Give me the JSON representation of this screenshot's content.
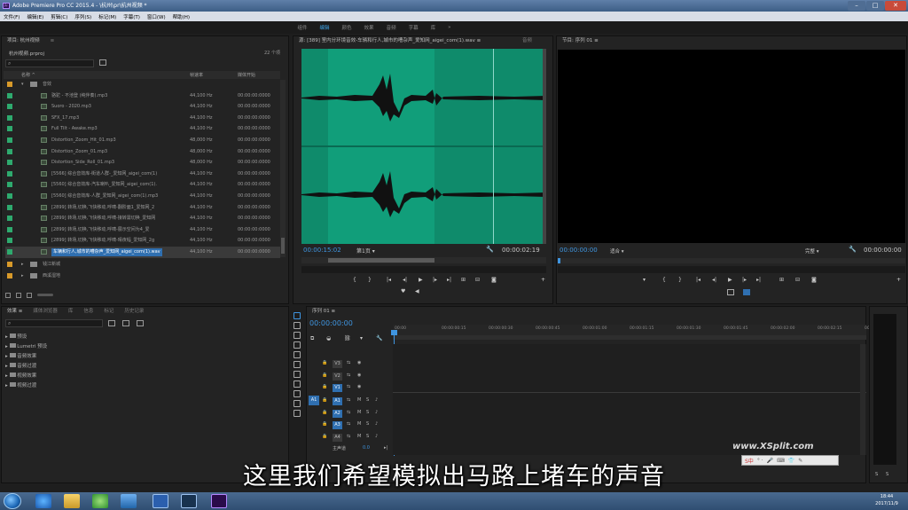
{
  "window": {
    "title": "Adobe Premiere Pro CC 2015.4 - \\杭州\\pr\\杭州视频 *",
    "app_icon": "Pr"
  },
  "menu": [
    "文件(F)",
    "编辑(E)",
    "剪辑(C)",
    "序列(S)",
    "标记(M)",
    "字幕(T)",
    "窗口(W)",
    "帮助(H)"
  ],
  "workspaces": {
    "items": [
      "组件",
      "编辑",
      "颜色",
      "效果",
      "音频",
      "字幕",
      "库"
    ],
    "active_index": 1
  },
  "project": {
    "tabs": [
      "项目: 杭州视频",
      "≡"
    ],
    "file": "杭州视频.prproj",
    "item_count": "22 个项",
    "columns": {
      "name": "名称 ^",
      "rate": "帧速率",
      "start": "媒体开始"
    },
    "bins": [
      {
        "name": "音效",
        "color": "#d89a2a"
      }
    ],
    "items": [
      {
        "name": "骆驼 - 不池登 (纯伴奏).mp3",
        "rate": "44,100 Hz",
        "start": "00:00:00:0000"
      },
      {
        "name": "Suoro - 2020.mp3",
        "rate": "44,100 Hz",
        "start": "00:00:00:0000"
      },
      {
        "name": "SFX_17.mp3",
        "rate": "44,100 Hz",
        "start": "00:00:00:0000"
      },
      {
        "name": "Full Tilt - Awake.mp3",
        "rate": "44,100 Hz",
        "start": "00:00:00:0000"
      },
      {
        "name": "Distortion_Zoom_Hit_01.mp3",
        "rate": "48,000 Hz",
        "start": "00:00:00:0000"
      },
      {
        "name": "Distortion_Zoom_01.mp3",
        "rate": "48,000 Hz",
        "start": "00:00:00:0000"
      },
      {
        "name": "Distortion_Side_Roll_01.mp3",
        "rate": "48,000 Hz",
        "start": "00:00:00:0000"
      },
      {
        "name": "[5566] 综合音效库-街道人群-_爱知网_aigei_com(1)",
        "rate": "44,100 Hz",
        "start": "00:00:00:0000"
      },
      {
        "name": "[5560] 综合音效库-汽车喇叭_爱知网_aigei_com(1).",
        "rate": "44,100 Hz",
        "start": "00:00:00:0000"
      },
      {
        "name": "[5560] 综合音效库-人群_爱知网_aigei_com(1).mp3",
        "rate": "44,100 Hz",
        "start": "00:00:00:0000"
      },
      {
        "name": "[2899] 转场,切换,飞快移动,呼啸-翻阶面1_爱知网_2",
        "rate": "44,100 Hz",
        "start": "00:00:00:0000"
      },
      {
        "name": "[2899] 转场,切换,飞快移动,呼啸-接转需切换_爱知网",
        "rate": "44,100 Hz",
        "start": "00:00:00:0000"
      },
      {
        "name": "[2899] 转场,切换,飞快移动,呼啸-展示空间为4_爱",
        "rate": "44,100 Hz",
        "start": "00:00:00:0000"
      },
      {
        "name": "[2899] 转场,切换,飞快移动,呼啸-晴夜幅_爱知网_2g",
        "rate": "44,100 Hz",
        "start": "00:00:00:0000"
      },
      {
        "name": "车辆和行人,城市的嘈杂声_爱知网_aigei_com(1).wav",
        "rate": "44,100 Hz",
        "start": "00:00:00:0000"
      }
    ],
    "folders": [
      {
        "name": "钱江新城",
        "color": "#d89a2a"
      },
      {
        "name": "西溪湿地",
        "color": "#d89a2a"
      }
    ]
  },
  "source": {
    "tab": "源: [389] 室内分环境音效-车辆和行人,城市的嘈杂声_爱知网_aigei_com(1).wav ≡",
    "tab2": "音频",
    "timecode_in": "00:00:15:02",
    "page": "第1页",
    "timecode_out": "00:00:02:19"
  },
  "program": {
    "tab": "节目: 序列 01 ≡",
    "timecode": "00:00:00:00",
    "fit": "适合",
    "quality": "完整",
    "duration": "00:00:00:00"
  },
  "effects": {
    "tabs": [
      "效果 ≡",
      "媒体浏览器",
      "库",
      "信息",
      "标记",
      "历史记录"
    ],
    "items": [
      "预设",
      "Lumetri 预设",
      "音频效果",
      "音频过渡",
      "视频效果",
      "视频过渡"
    ]
  },
  "timeline": {
    "tab": "序列 01 ≡",
    "timecode": "00:00:00:00",
    "ruler": [
      "00:00",
      "00:00:00:15",
      "00:00:00:30",
      "00:00:00:45",
      "00:00:01:00",
      "00:00:01:15",
      "00:00:01:30",
      "00:00:01:45",
      "00:00:02:00",
      "00:00:02:15",
      "00:00:02:30"
    ],
    "video_tracks": [
      "V3",
      "V2",
      "V1"
    ],
    "audio_tracks": [
      "A1",
      "A2",
      "A3",
      "A4"
    ],
    "master": "主声道",
    "master_val": "0.0",
    "source_patch_audio": "A1"
  },
  "meter": {
    "labels": [
      "S",
      "S"
    ]
  },
  "subtitle": "这里我们希望模拟出马路上堵车的声音",
  "watermark": "www.XSplit.com",
  "ime": "S中",
  "taskbar": {
    "time": "18:44",
    "date": "2017/11/9"
  }
}
